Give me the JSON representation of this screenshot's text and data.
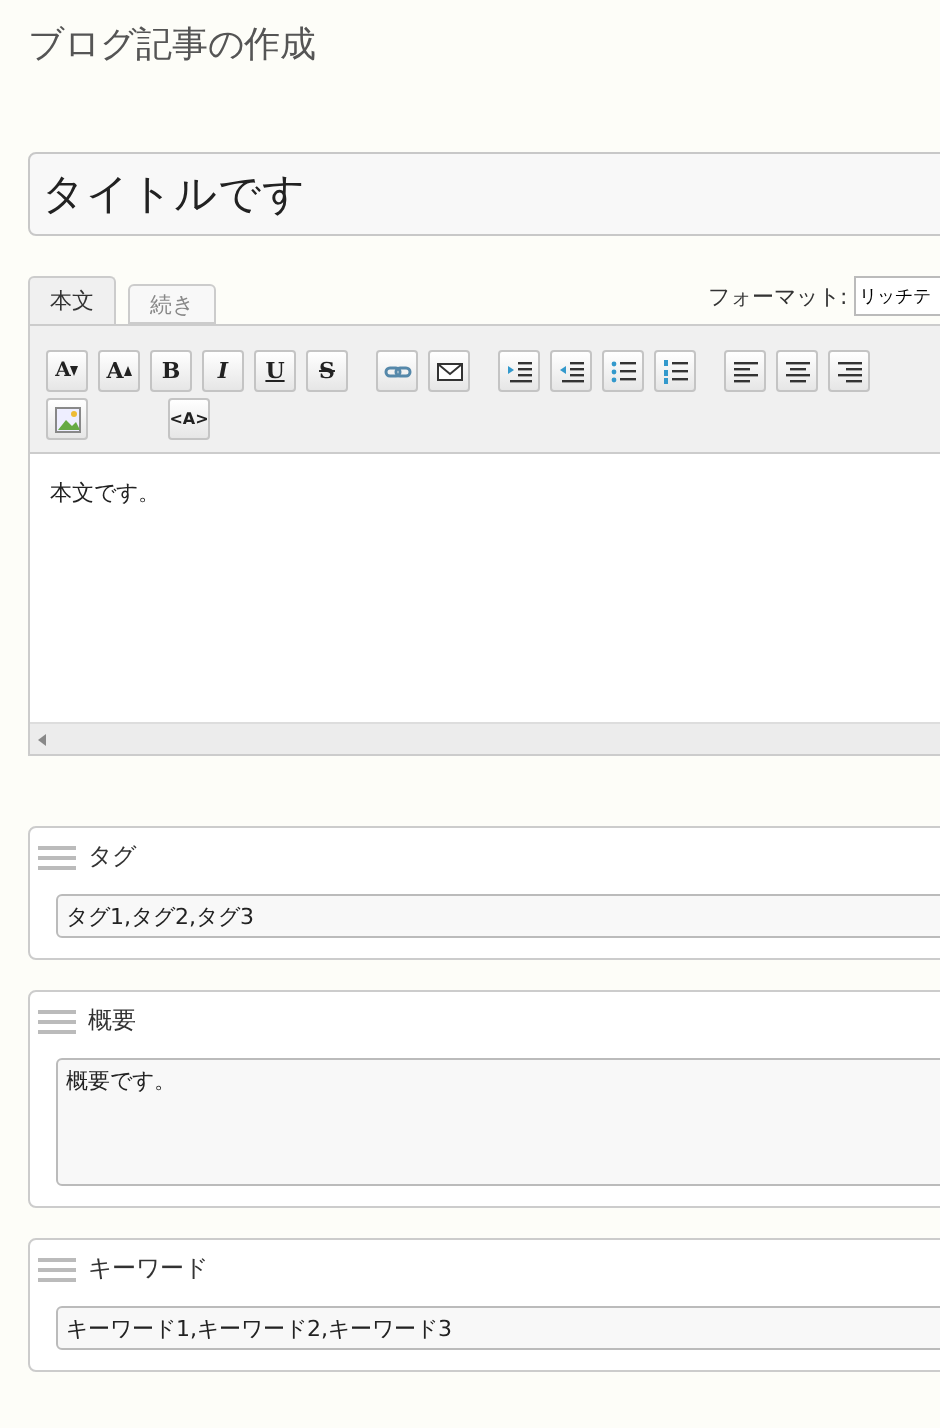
{
  "page_title": "ブログ記事の作成",
  "title_field": {
    "value": "タイトルです"
  },
  "editor": {
    "tabs": [
      {
        "label": "本文",
        "selected": true
      },
      {
        "label": "続き",
        "selected": false
      }
    ],
    "format": {
      "label": "フォーマット:",
      "value": "リッチテ"
    },
    "toolbar": [
      [
        {
          "kind": "font-down",
          "label": "A"
        },
        {
          "kind": "font-up",
          "label": "A"
        },
        {
          "kind": "bold",
          "label": "B"
        },
        {
          "kind": "italic",
          "label": "I"
        },
        {
          "kind": "underline",
          "label": "U"
        },
        {
          "kind": "strike",
          "label": "S"
        }
      ],
      [
        {
          "kind": "link"
        },
        {
          "kind": "mail"
        }
      ],
      [
        {
          "kind": "indent"
        },
        {
          "kind": "outdent"
        },
        {
          "kind": "bullets"
        },
        {
          "kind": "numbers"
        }
      ],
      [
        {
          "kind": "align-left"
        },
        {
          "kind": "align-center"
        },
        {
          "kind": "align-right"
        }
      ],
      [
        {
          "kind": "image"
        }
      ],
      [
        {
          "kind": "source",
          "label": "<A>"
        }
      ]
    ],
    "body": "本文です。"
  },
  "panels": [
    {
      "label": "タグ",
      "kind": "line",
      "value": "タグ1,タグ2,タグ3"
    },
    {
      "label": "概要",
      "kind": "area",
      "value": "概要です。"
    },
    {
      "label": "キーワード",
      "kind": "line",
      "value": "キーワード1,キーワード2,キーワード3"
    }
  ]
}
